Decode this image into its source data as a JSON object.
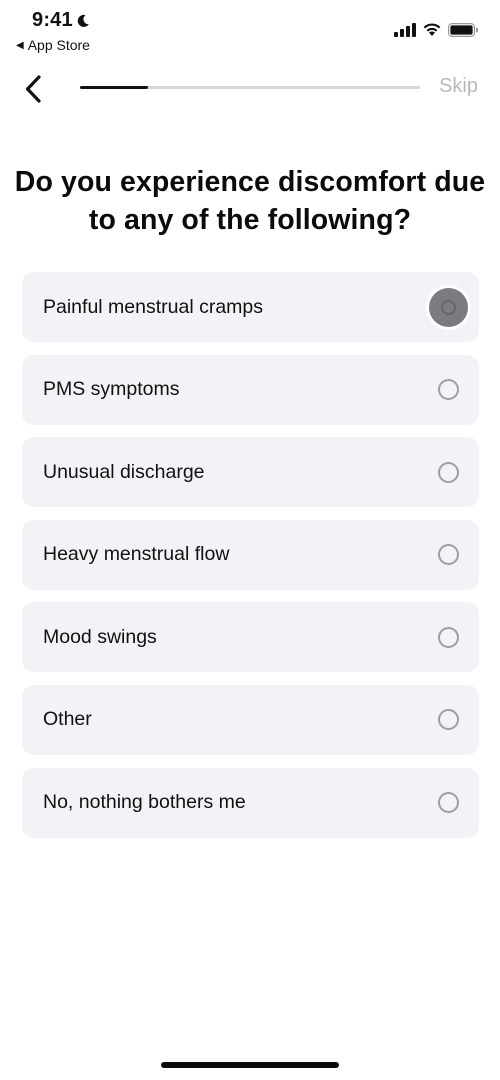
{
  "status_bar": {
    "time": "9:41",
    "focus_icon": "moon-icon",
    "back_app_label": "App Store",
    "signal_icon": "cellular-signal-icon",
    "wifi_icon": "wifi-icon",
    "battery_icon": "battery-icon"
  },
  "nav": {
    "back_icon": "chevron-left-icon",
    "progress_fraction": 0.2,
    "skip_label": "Skip"
  },
  "question": {
    "title": "Do you experience discomfort due to any of the following?"
  },
  "options": [
    {
      "label": "Painful menstrual cramps",
      "selected": false,
      "pressed": true
    },
    {
      "label": "PMS symptoms",
      "selected": false,
      "pressed": false
    },
    {
      "label": "Unusual discharge",
      "selected": false,
      "pressed": false
    },
    {
      "label": "Heavy menstrual flow",
      "selected": false,
      "pressed": false
    },
    {
      "label": "Mood swings",
      "selected": false,
      "pressed": false
    },
    {
      "label": "Other",
      "selected": false,
      "pressed": false
    },
    {
      "label": "No, nothing bothers me",
      "selected": false,
      "pressed": false
    }
  ],
  "colors": {
    "option_background": "#f3f2f6",
    "progress_track": "#d6d6d9",
    "progress_fill": "#111111",
    "skip_text": "#b8b8bd",
    "radio_border": "#9d9da2"
  }
}
